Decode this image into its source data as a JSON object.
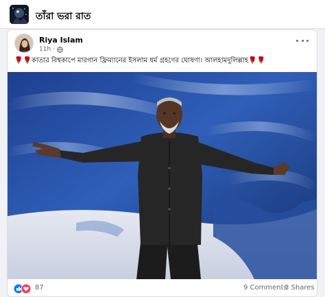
{
  "group": {
    "title": "তাঁরা ভরা রাত",
    "avatar_icon": "group-avatar-image"
  },
  "post": {
    "author_name": "Riya Islam",
    "timestamp": "11h",
    "privacy_icon": "globe-icon",
    "text": "🌹🌹কাতার বিশ্বকাপে মারগান ফ্রিম্যানের ইসলাম ধর্ম গ্রহণের ঘোষণা। আলহামদুলিল্লাহ🌹🌹",
    "image_icon": "man-on-stage-photo",
    "reactions": {
      "count": "87",
      "icons": [
        "like-icon",
        "love-icon"
      ]
    },
    "comments_label": "9 Comments",
    "shares_label": "3 Shares"
  },
  "colors": {
    "like": "#1877f2",
    "love": "#f33e58",
    "muted_text": "#65676b",
    "card_bg": "#ffffff",
    "page_bg": "#f0f2f5"
  }
}
